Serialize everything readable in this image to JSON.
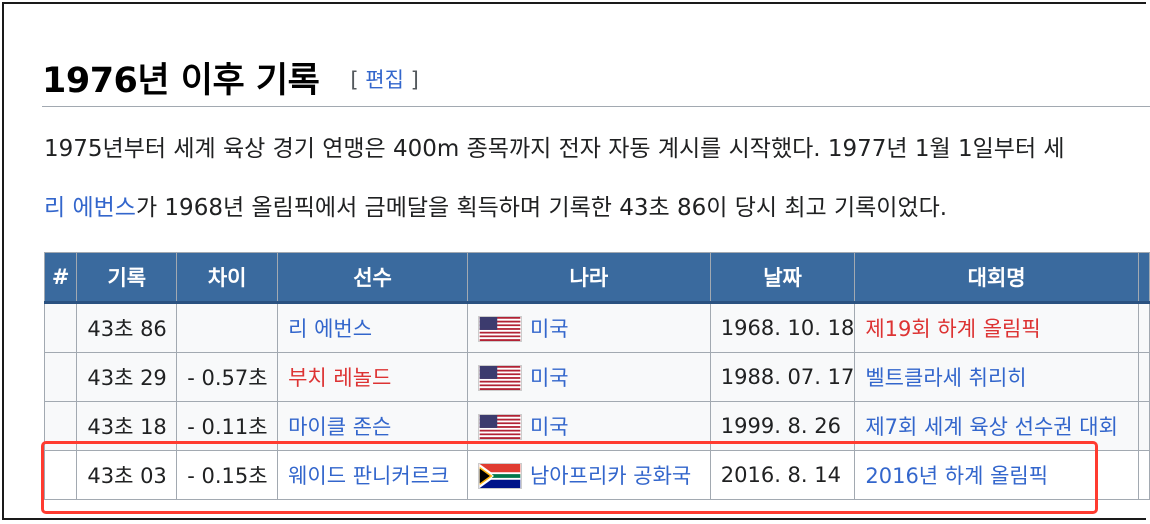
{
  "section": {
    "title": "1976년 이후 기록",
    "edit_open": "[",
    "edit_label": "편집",
    "edit_close": "]"
  },
  "paragraph": {
    "line1": "1975년부터 세계 육상 경기 연맹은 400m 종목까지 전자 자동 계시를 시작했다. 1977년 1월 1일부터 세",
    "line2_link": "리 에번스",
    "line2_rest": "가 1968년 올림픽에서 금메달을 획득하며 기록한 43초 86이 당시 최고 기록이었다."
  },
  "table": {
    "headers": [
      "#",
      "기록",
      "차이",
      "선수",
      "나라",
      "날짜",
      "대회명"
    ],
    "rows": [
      {
        "num": "",
        "record": "43초 86",
        "diff": "",
        "athlete": "리 에번스",
        "athlete_color": "#3366cc",
        "flag": "us-flag-icon",
        "country": "미국",
        "date": "1968. 10. 18",
        "event": "제19회 하계 올림픽",
        "event_color": "#dd3333"
      },
      {
        "num": "",
        "record": "43초 29",
        "diff": "- 0.57초",
        "athlete": "부치 레놀드",
        "athlete_color": "#dd3333",
        "flag": "us-flag-icon",
        "country": "미국",
        "date": "1988. 07. 17",
        "event": "벨트클라세 취리히",
        "event_color": "#3366cc"
      },
      {
        "num": "",
        "record": "43초 18",
        "diff": "- 0.11초",
        "athlete": "마이클 존슨",
        "athlete_color": "#3366cc",
        "flag": "us-flag-icon",
        "country": "미국",
        "date": "1999. 8. 26",
        "event": "제7회 세계 육상 선수권 대회",
        "event_color": "#3366cc"
      },
      {
        "num": "",
        "record": "43초 03",
        "diff": "- 0.15초",
        "athlete": "웨이드 판니커르크",
        "athlete_color": "#3366cc",
        "flag": "za-flag-icon",
        "country": "남아프리카 공화국",
        "date": "2016. 8. 14",
        "event": "2016년 하계 올림픽",
        "event_color": "#3366cc"
      }
    ]
  },
  "colors": {
    "link": "#3366cc",
    "redlink": "#dd3333",
    "header_bg": "#3a6a9e",
    "highlight": "#ff3b30"
  }
}
